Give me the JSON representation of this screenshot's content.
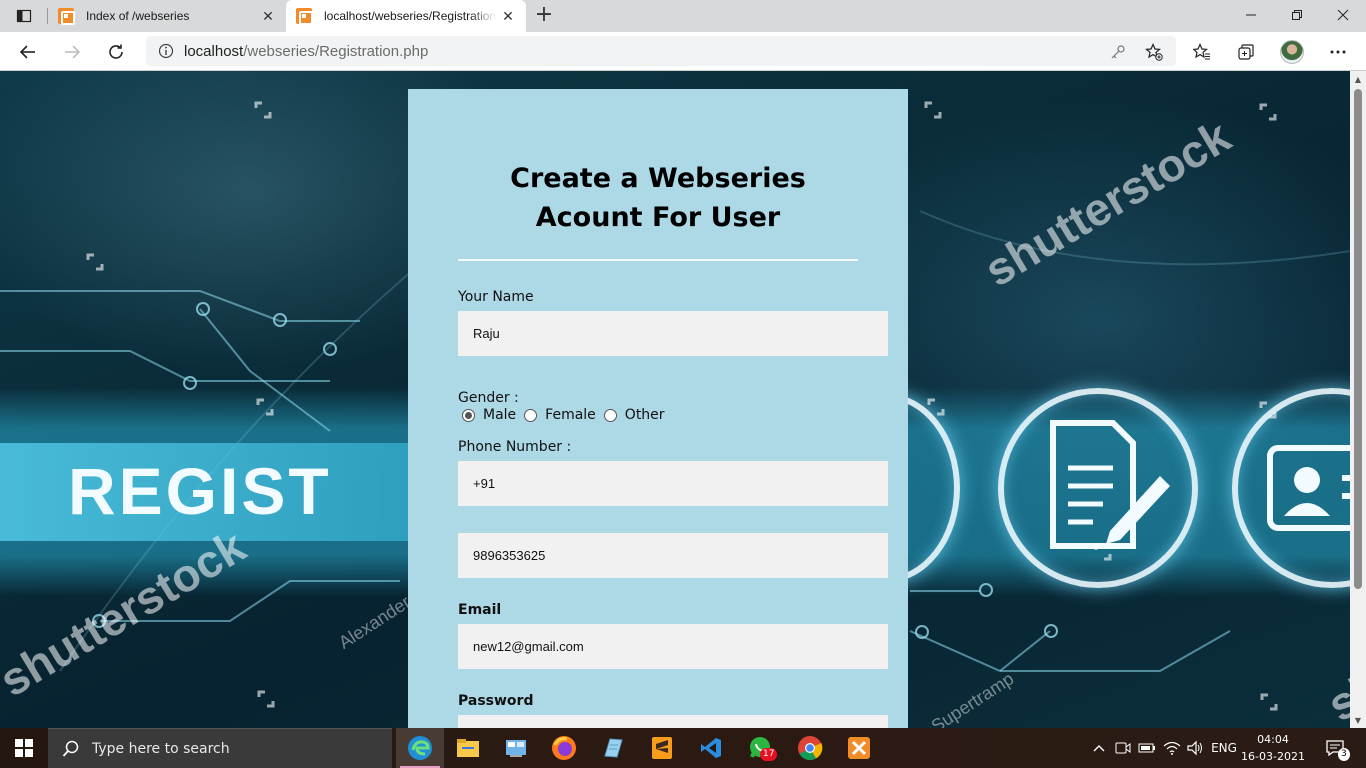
{
  "browser": {
    "tabs": [
      {
        "title": "Index of /webseries",
        "active": false
      },
      {
        "title": "localhost/webseries/Registration.php",
        "active": true
      }
    ],
    "address": {
      "host": "localhost",
      "path": "/webseries/Registration.php"
    }
  },
  "background": {
    "hero_text": "REGIST",
    "watermark_brand": "shutterstock",
    "watermark_credit_1": "Alexander",
    "watermark_credit_2": "er Supertramp",
    "watermark_partial": "sh"
  },
  "form": {
    "title": "Create a Webseries Acount For User",
    "name_label": "Your Name",
    "name_value": "Raju",
    "gender_label": "Gender :",
    "gender_options": [
      "Male",
      "Female",
      "Other"
    ],
    "gender_selected": "Male",
    "phone_label": "Phone Number :",
    "country_code": "+91",
    "phone_value": "9896353625",
    "email_label": "Email",
    "email_value": "new12@gmail.com",
    "password_label": "Password"
  },
  "taskbar": {
    "search_placeholder": "Type here to search",
    "language": "ENG",
    "time": "04:04",
    "date": "16-03-2021",
    "whatsapp_badge": "17",
    "notification_count": "3",
    "apps": [
      "edge-icon",
      "file-explorer-icon",
      "control-panel-icon",
      "firefox-icon",
      "notepad-icon",
      "sublime-icon",
      "vscode-icon",
      "whatsapp-icon",
      "chrome-icon",
      "xampp-icon"
    ]
  },
  "colors": {
    "card_bg": "#add8e6",
    "input_bg": "#f1f1f1",
    "tabbar_bg": "#d8d9da",
    "xampp_orange": "#f28c28"
  }
}
